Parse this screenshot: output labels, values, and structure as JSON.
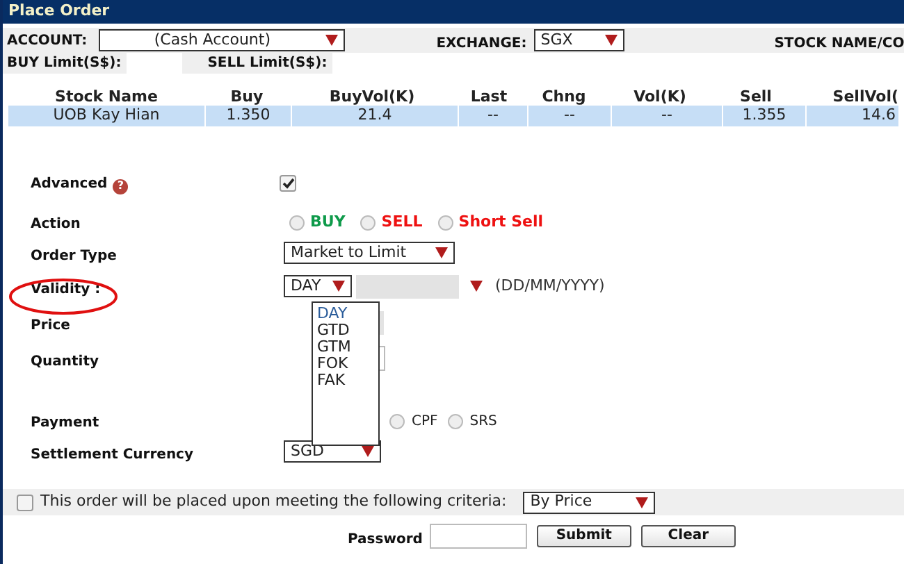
{
  "window": {
    "title": "Place Order"
  },
  "account": {
    "label": "ACCOUNT:",
    "value": "(Cash Account)"
  },
  "exchange": {
    "label": "EXCHANGE:",
    "value": "SGX"
  },
  "stock_name_label": "STOCK NAME/CO",
  "limits": [
    {
      "label": "BUY Limit(S$):"
    },
    {
      "label": "SELL Limit(S$):"
    }
  ],
  "table": {
    "columns": [
      "Stock Name",
      "Buy",
      "BuyVol(K)",
      "Last",
      "Chng",
      "Vol(K)",
      "Sell",
      "SellVol("
    ],
    "rows": [
      [
        "UOB Kay Hian",
        "1.350",
        "21.4",
        "--",
        "--",
        "--",
        "1.355",
        "14.6"
      ]
    ]
  },
  "advanced": {
    "label": "Advanced",
    "checked": true,
    "help_icon": "?"
  },
  "action": {
    "label": "Action",
    "options": [
      {
        "label": "BUY",
        "selected": false,
        "color": "#0e9a4a"
      },
      {
        "label": "SELL",
        "selected": false,
        "color": "#ee1111"
      },
      {
        "label": "Short Sell",
        "selected": false,
        "color": "#ee1111"
      }
    ]
  },
  "order_type": {
    "label": "Order Type",
    "value": "Market to Limit"
  },
  "validity": {
    "label": "Validity :",
    "value": "DAY",
    "date_hint": "(DD/MM/YYYY)",
    "options": [
      {
        "label": "DAY",
        "selected": true
      },
      {
        "label": "GTD",
        "selected": false
      },
      {
        "label": "GTM",
        "selected": false
      },
      {
        "label": "FOK",
        "selected": false
      },
      {
        "label": "FAK",
        "selected": false
      }
    ]
  },
  "price": {
    "label": "Price"
  },
  "quantity": {
    "label": "Quantity"
  },
  "payment": {
    "label": "Payment",
    "options": [
      {
        "label": "CPF",
        "selected": false
      },
      {
        "label": "SRS",
        "selected": false
      }
    ]
  },
  "settlement_currency": {
    "label": "Settlement Currency",
    "value": "SGD"
  },
  "criteria": {
    "label": "This order will be placed upon meeting the following criteria:",
    "checked": false,
    "value": "By Price"
  },
  "password": {
    "label": "Password"
  },
  "buttons": [
    "Submit",
    "Clear"
  ]
}
